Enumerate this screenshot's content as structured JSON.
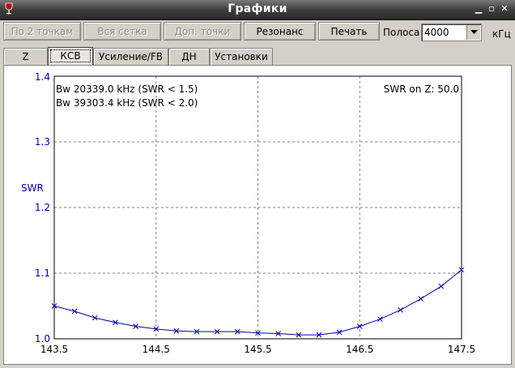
{
  "window": {
    "title": "Графики"
  },
  "toolbar": {
    "buttons": [
      {
        "label": "По 2 точкам",
        "enabled": false
      },
      {
        "label": "Вся сетка",
        "enabled": false
      },
      {
        "label": "Доп. точки",
        "enabled": false
      },
      {
        "label": "Резонанс",
        "enabled": true
      },
      {
        "label": "Печать",
        "enabled": true
      }
    ],
    "band_label": "Полоса",
    "band_value": "4000",
    "unit_label": "кГц"
  },
  "tabs": [
    {
      "label": "Z",
      "active": false
    },
    {
      "label": "КСВ",
      "active": true
    },
    {
      "label": "Усиление/FB",
      "active": false
    },
    {
      "label": "ДН",
      "active": false
    },
    {
      "label": "Установки",
      "active": false
    }
  ],
  "chart_data": {
    "type": "line",
    "ylabel": "SWR",
    "xlim": [
      143.5,
      147.5
    ],
    "ylim": [
      1.0,
      1.4
    ],
    "x_ticks": [
      "143.5",
      "144.5",
      "145.5",
      "146.5",
      "147.5"
    ],
    "y_ticks": [
      "1.0",
      "1.1",
      "1.2",
      "1.3",
      "1.4"
    ],
    "grid": true,
    "annotations": [
      "Bw 20339.0 kHz (SWR < 1.5)",
      "Bw 39303.4 kHz (SWR < 2.0)",
      "SWR on Z: 50.0"
    ],
    "series": [
      {
        "color": "#0000aa",
        "marker": "x",
        "x": [
          143.5,
          143.7,
          143.9,
          144.1,
          144.3,
          144.5,
          144.7,
          144.9,
          145.1,
          145.3,
          145.5,
          145.7,
          145.9,
          146.1,
          146.3,
          146.5,
          146.7,
          146.9,
          147.1,
          147.3,
          147.5
        ],
        "y": [
          1.05,
          1.042,
          1.032,
          1.025,
          1.019,
          1.015,
          1.012,
          1.011,
          1.011,
          1.011,
          1.009,
          1.008,
          1.006,
          1.006,
          1.01,
          1.019,
          1.03,
          1.044,
          1.061,
          1.08,
          1.105
        ]
      }
    ]
  }
}
